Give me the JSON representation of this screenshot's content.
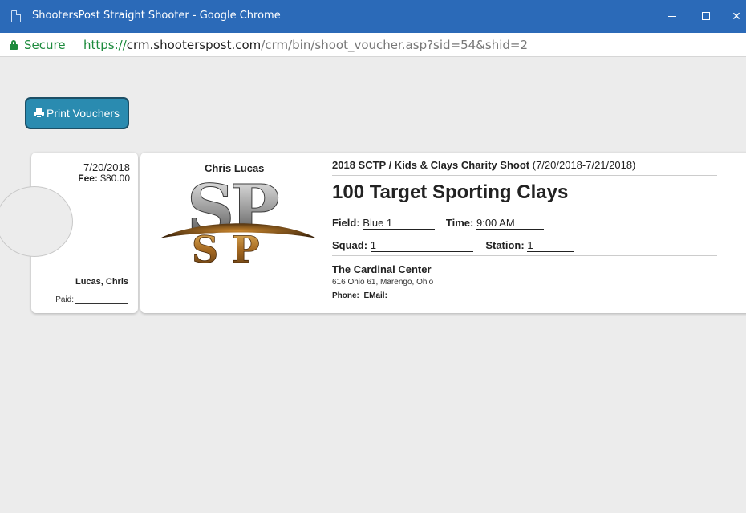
{
  "window": {
    "title": "ShootersPost Straight Shooter - Google Chrome"
  },
  "address_bar": {
    "secure_label": "Secure",
    "url_scheme": "https://",
    "url_host": "crm.shooterspost.com",
    "url_path": "/crm/bin/shoot_voucher.asp?sid=54&shid=2"
  },
  "toolbar": {
    "print_label": "Print Vouchers"
  },
  "stub": {
    "date": "7/20/2018",
    "fee_label": "Fee:",
    "fee_value": " $80.00",
    "name": "Lucas, Chris",
    "paid_label": "Paid:"
  },
  "voucher": {
    "shooter_name": "Chris Lucas",
    "event_name": "2018 SCTP / Kids & Clays Charity Shoot",
    "event_dates": " (7/20/2018-7/21/2018)",
    "shoot_name": "100 Target Sporting Clays",
    "field_label": "Field:",
    "field_value": "Blue 1",
    "time_label": "Time:",
    "time_value": "9:00 AM",
    "squad_label": "Squad:",
    "squad_value": "1",
    "station_label": "Station:",
    "station_value": "1",
    "venue_name": "The Cardinal Center",
    "venue_address": "616 Ohio 61, Marengo, Ohio",
    "phone_label": "Phone:",
    "email_label": "EMail:"
  },
  "icons": {
    "page": "document-icon",
    "lock": "lock-icon",
    "print": "printer-icon"
  },
  "colors": {
    "titlebar": "#2b6ab8",
    "secure": "#1c8a3c",
    "print_button": "#2a8bb0"
  }
}
